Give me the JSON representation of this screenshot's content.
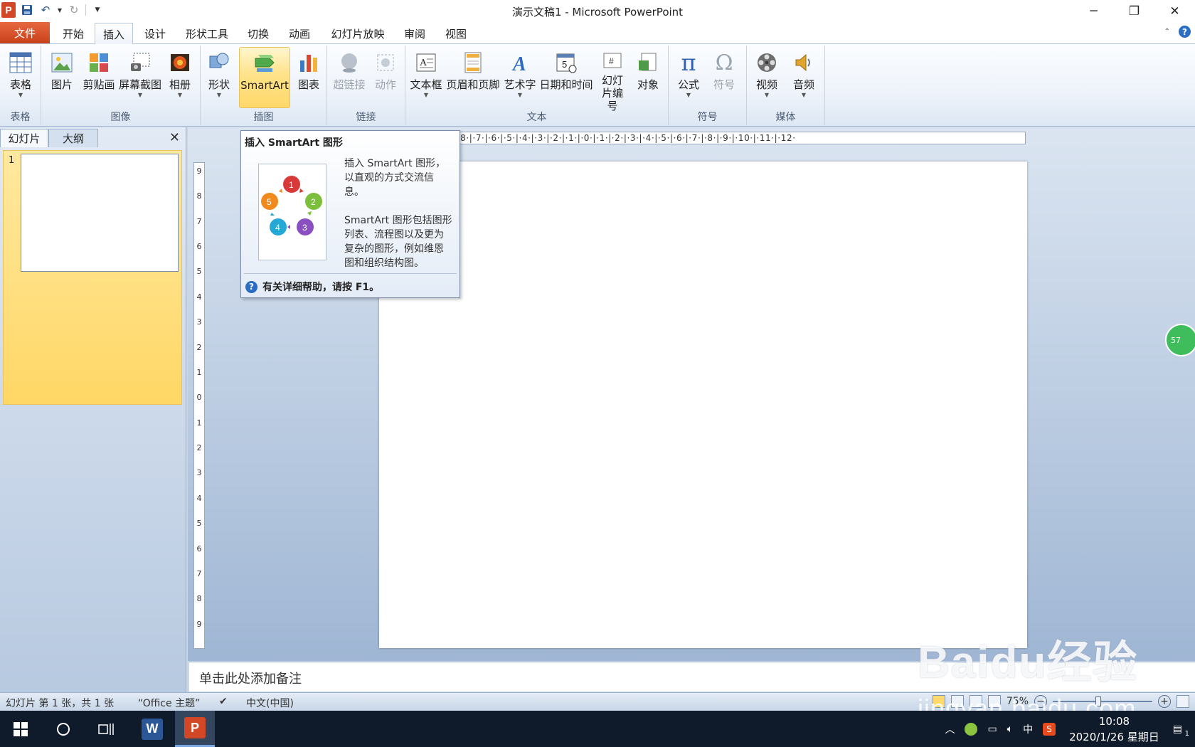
{
  "window": {
    "title": "演示文稿1 - Microsoft PowerPoint",
    "app_logo": "P",
    "controls": [
      "minimize-icon",
      "restore-icon",
      "close-icon"
    ]
  },
  "quick_access": [
    "save-icon",
    "undo-icon",
    "redo-icon",
    "customize-icon"
  ],
  "tabs": {
    "file": "文件",
    "items": [
      "开始",
      "插入",
      "设计",
      "形状工具",
      "切换",
      "动画",
      "幻灯片放映",
      "审阅",
      "视图"
    ],
    "active": "插入"
  },
  "ribbon": {
    "groups": [
      {
        "label": "表格",
        "buttons": [
          "表格"
        ]
      },
      {
        "label": "图像",
        "buttons": [
          "图片",
          "剪贴画",
          "屏幕截图",
          "相册"
        ]
      },
      {
        "label": "插图",
        "buttons": [
          "形状",
          "SmartArt",
          "图表"
        ]
      },
      {
        "label": "链接",
        "buttons": [
          "超链接",
          "动作"
        ]
      },
      {
        "label": "文本",
        "buttons": [
          "文本框",
          "页眉和页脚",
          "艺术字",
          "日期和时间",
          "幻灯片编号",
          "对象"
        ]
      },
      {
        "label": "符号",
        "buttons": [
          "公式",
          "符号"
        ]
      },
      {
        "label": "媒体",
        "buttons": [
          "视频",
          "音频"
        ]
      }
    ],
    "highlighted": "SmartArt",
    "disabled": [
      "超链接",
      "动作",
      "符号"
    ]
  },
  "slides_panel": {
    "tab_slides": "幻灯片",
    "tab_outline": "大纲",
    "slide_number": "1"
  },
  "tooltip": {
    "title": "插入 SmartArt 图形",
    "desc1": "插入 SmartArt 图形，以直观的方式交流信息。",
    "desc2": "SmartArt 图形包括图形列表、流程图以及更为复杂的图形，例如维恩图和组织结构图。",
    "help": "有关详细帮助，请按 F1。",
    "diagram_numbers": [
      "1",
      "2",
      "3",
      "4",
      "5"
    ]
  },
  "rulers": {
    "horizontal": "·9·|·8·|·7·|·6·|·5·|·4·|·3·|·2·|·1·|·0·|·1·|·2·|·3·|·4·|·5·|·6·|·7·|·8·|·9·|·10·|·11·|·12·",
    "vertical": [
      "9",
      "8",
      "7",
      "6",
      "5",
      "4",
      "3",
      "2",
      "1",
      "0",
      "1",
      "2",
      "3",
      "4",
      "5",
      "6",
      "7",
      "8",
      "9"
    ]
  },
  "notes_placeholder": "单击此处添加备注",
  "side_badge": "57",
  "statusbar": {
    "slide_info": "幻灯片 第 1 张，共 1 张",
    "theme": "“Office 主题”",
    "language": "中文(中国)",
    "zoom": "75%"
  },
  "taskbar": {
    "ime": "中",
    "time": "10:08",
    "date": "2020/1/26 星期日",
    "notifications": "1",
    "word_label": "W",
    "ppt_label": "P"
  },
  "watermark": {
    "text": "Baidu经验",
    "url": "jingyan.baidu.com"
  },
  "colors": {
    "file_tab": "#d24726",
    "ribbon_highlight": "#ffd86a",
    "workspace": "#b7c9e0",
    "taskbar": "#0f1a2a"
  }
}
